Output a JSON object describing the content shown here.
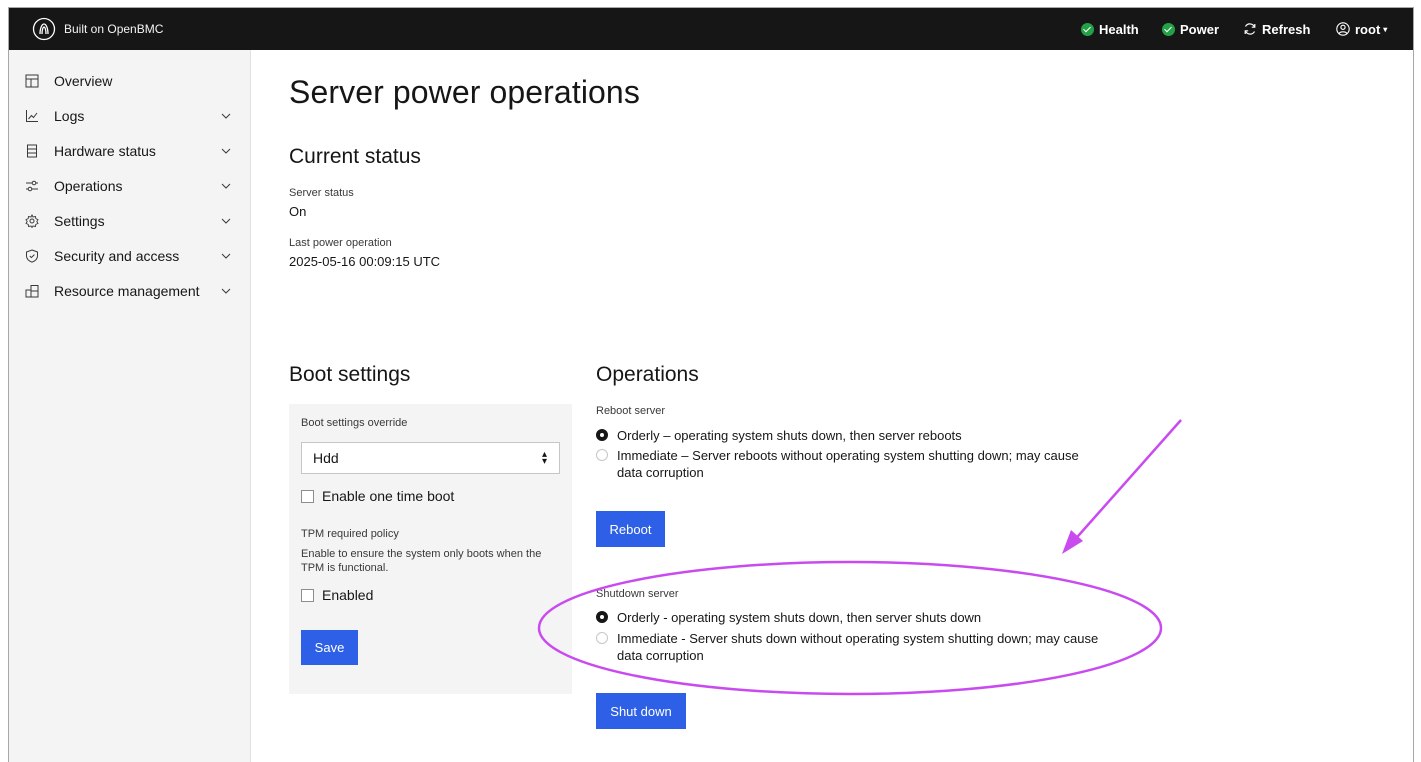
{
  "header": {
    "brand": "Built on OpenBMC",
    "health_label": "Health",
    "power_label": "Power",
    "refresh_label": "Refresh",
    "user_label": "root",
    "status_color": "#24a148"
  },
  "sidebar": {
    "items": [
      {
        "label": "Overview",
        "icon": "dashboard-icon",
        "expandable": false
      },
      {
        "label": "Logs",
        "icon": "chart-icon",
        "expandable": true
      },
      {
        "label": "Hardware status",
        "icon": "server-icon",
        "expandable": true
      },
      {
        "label": "Operations",
        "icon": "sliders-icon",
        "expandable": true
      },
      {
        "label": "Settings",
        "icon": "gear-icon",
        "expandable": true
      },
      {
        "label": "Security and access",
        "icon": "shield-icon",
        "expandable": true
      },
      {
        "label": "Resource management",
        "icon": "resources-icon",
        "expandable": true
      }
    ]
  },
  "page": {
    "title": "Server power operations"
  },
  "current_status": {
    "title": "Current status",
    "server_status_label": "Server status",
    "server_status_value": "On",
    "last_op_label": "Last power operation",
    "last_op_value": "2025-05-16 00:09:15 UTC"
  },
  "boot_settings": {
    "title": "Boot settings",
    "override_label": "Boot settings override",
    "override_value": "Hdd",
    "one_time_boot_label": "Enable one time boot",
    "tpm_title": "TPM required policy",
    "tpm_description": "Enable to ensure the system only boots when the TPM is functional.",
    "tpm_enabled_label": "Enabled",
    "save_label": "Save"
  },
  "operations": {
    "title": "Operations",
    "reboot": {
      "label": "Reboot server",
      "options": [
        {
          "label": "Orderly – operating system shuts down, then server reboots",
          "checked": true
        },
        {
          "label": "Immediate – Server reboots without operating system shutting down; may cause data corruption",
          "checked": false
        }
      ],
      "button": "Reboot"
    },
    "shutdown": {
      "label": "Shutdown server",
      "options": [
        {
          "label": "Orderly - operating system shuts down, then server shuts down",
          "checked": true
        },
        {
          "label": "Immediate - Server shuts down without operating system shutting down; may cause data corruption",
          "checked": false
        }
      ],
      "button": "Shut down"
    }
  },
  "colors": {
    "primary_button": "#2d60e6",
    "annotation": "#c94bf0"
  }
}
